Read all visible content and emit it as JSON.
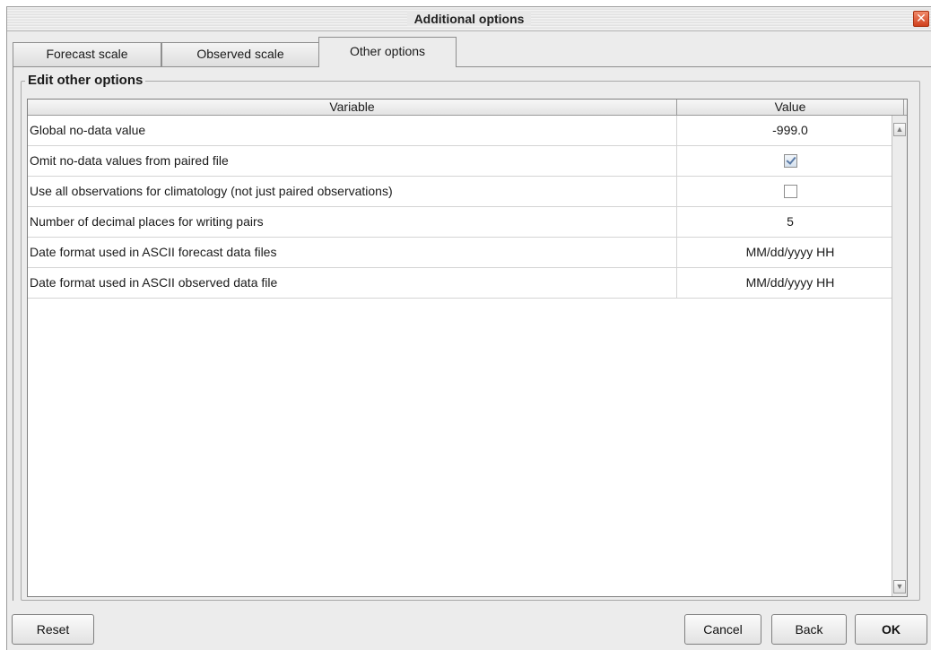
{
  "window": {
    "title": "Additional options",
    "close_glyph": "✕"
  },
  "tabs": [
    {
      "label": "Forecast scale",
      "active": false
    },
    {
      "label": "Observed scale",
      "active": false
    },
    {
      "label": "Other options",
      "active": true
    }
  ],
  "group": {
    "title": "Edit other options"
  },
  "table": {
    "columns": [
      "Variable",
      "Value"
    ],
    "rows": [
      {
        "variable": "Global no-data value",
        "value": "-999.0",
        "type": "text"
      },
      {
        "variable": "Omit no-data values from paired file",
        "value": true,
        "type": "checkbox"
      },
      {
        "variable": "Use all observations for climatology (not just paired observations)",
        "value": false,
        "type": "checkbox"
      },
      {
        "variable": "Number of decimal places for writing pairs",
        "value": "5",
        "type": "text"
      },
      {
        "variable": "Date format used in ASCII forecast data files",
        "value": "MM/dd/yyyy HH",
        "type": "text"
      },
      {
        "variable": "Date format used in ASCII observed data file",
        "value": "MM/dd/yyyy HH",
        "type": "text"
      }
    ]
  },
  "scrollbar": {
    "up_glyph": "▲",
    "down_glyph": "▼"
  },
  "buttons": {
    "reset": "Reset",
    "cancel": "Cancel",
    "back": "Back",
    "ok": "OK"
  },
  "icons": {
    "close": "close-icon",
    "scroll_up": "arrow-up-icon",
    "scroll_down": "arrow-down-icon",
    "checkbox": "checkbox-icon"
  },
  "colors": {
    "close_button": "#d0401d",
    "check_mark": "#5a7aa6"
  }
}
